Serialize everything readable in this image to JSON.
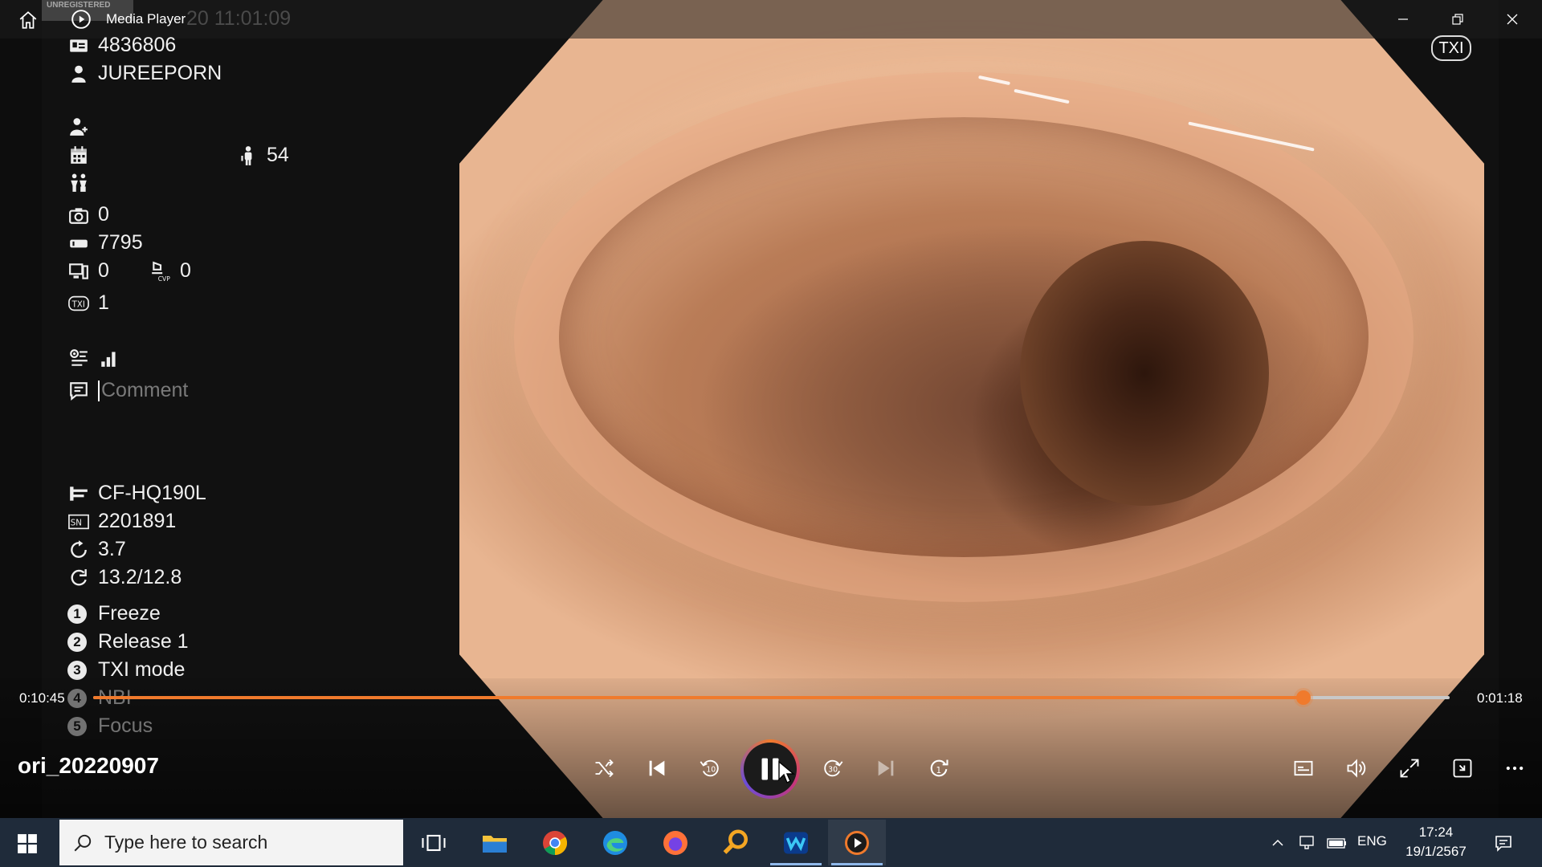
{
  "window": {
    "title": "Media Player",
    "unregistered_text": "UNREGISTERED",
    "overlay_datetime": "20 11:01:09",
    "txi_badge": "TXI"
  },
  "info_panel": {
    "patient_id": "4836806",
    "patient_name": "JUREEPORN",
    "age": "54",
    "photo_count": "0",
    "scope_counter": "7795",
    "monitor_count": "0",
    "cvp_count": "0",
    "txi_level": "1",
    "comment_placeholder": "Comment",
    "scope_model": "CF-HQ190L",
    "serial_number": "2201891",
    "value_1": "3.7",
    "value_2": "13.2/12.8",
    "menu": [
      {
        "number": "1",
        "label": "Freeze"
      },
      {
        "number": "2",
        "label": "Release 1"
      },
      {
        "number": "3",
        "label": "TXI mode"
      },
      {
        "number": "4",
        "label": "NBI"
      },
      {
        "number": "5",
        "label": "Focus"
      }
    ]
  },
  "player": {
    "file_name": "ori_20220907",
    "elapsed": "0:10:45",
    "remaining": "0:01:18",
    "progress": 0.8925,
    "accent_color": "#f07a2c"
  },
  "controls": {
    "icons": [
      "shuffle-icon",
      "previous-icon",
      "rewind-10-icon",
      "pause-icon",
      "forward-30-icon",
      "next-icon",
      "repeat-one-icon",
      "captions-icon",
      "volume-icon",
      "fullscreen-icon",
      "mini-player-icon",
      "more-icon"
    ]
  },
  "taskbar": {
    "search_placeholder": "Type here to search",
    "language": "ENG",
    "time": "17:24",
    "date": "19/1/2567",
    "background_color": "#1f2b3a"
  }
}
